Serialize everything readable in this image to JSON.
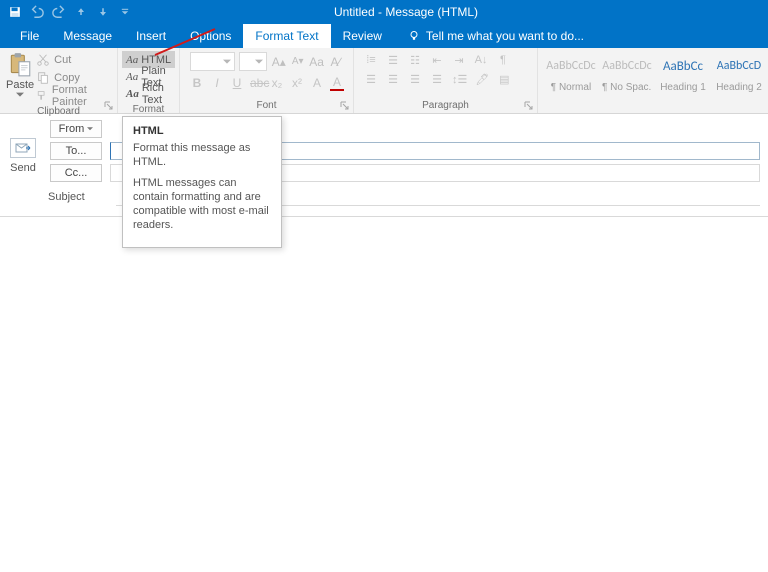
{
  "titlebar": {
    "title": "Untitled - Message (HTML)"
  },
  "tabs": {
    "file": "File",
    "message": "Message",
    "insert": "Insert",
    "options": "Options",
    "format_text": "Format Text",
    "review": "Review",
    "tell_me": "Tell me what you want to do..."
  },
  "ribbon": {
    "clipboard": {
      "label": "Clipboard",
      "paste": "Paste",
      "cut": "Cut",
      "copy": "Copy",
      "format_painter": "Format Painter"
    },
    "format": {
      "label": "Format",
      "html": "HTML",
      "plain": "Plain Text",
      "rich": "Rich Text"
    },
    "font": {
      "label": "Font"
    },
    "paragraph": {
      "label": "Paragraph"
    },
    "styles": {
      "items": [
        {
          "preview": "AaBbCcDc",
          "name": "¶ Normal"
        },
        {
          "preview": "AaBbCcDc",
          "name": "¶ No Spac..."
        },
        {
          "preview": "AaBbCc",
          "name": "Heading 1"
        },
        {
          "preview": "AaBbCcD",
          "name": "Heading 2"
        }
      ]
    }
  },
  "tooltip": {
    "title": "HTML",
    "line1": "Format this message as HTML.",
    "line2": "HTML messages can contain formatting and are compatible with most e-mail readers."
  },
  "compose": {
    "send": "Send",
    "from": "From",
    "to": "To...",
    "cc": "Cc...",
    "subject_label": "Subject",
    "su_marker": "Su"
  }
}
